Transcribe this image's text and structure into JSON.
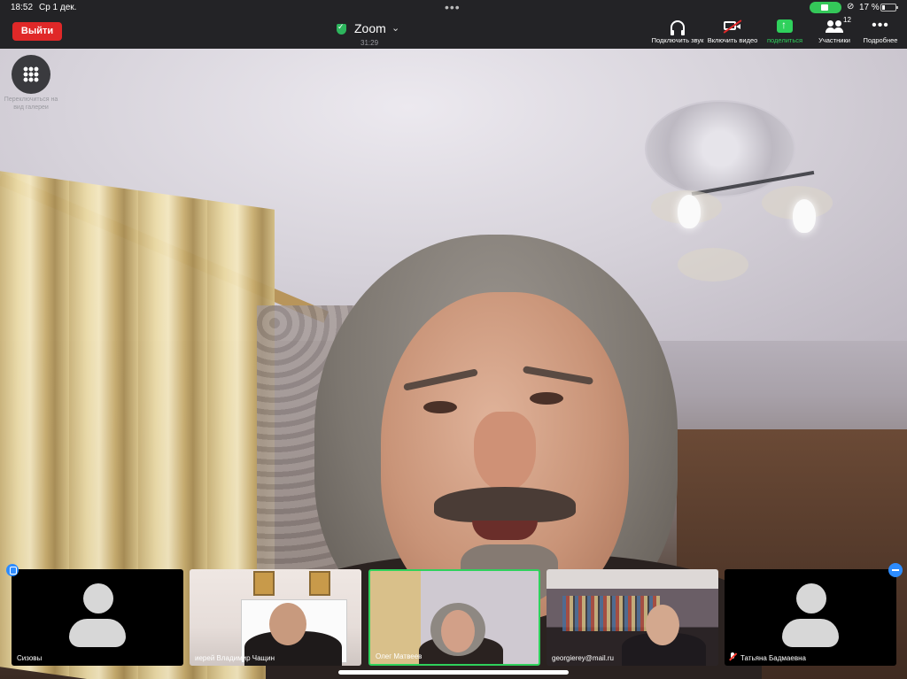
{
  "status": {
    "time": "18:52",
    "date": "Ср 1 дек.",
    "battery_percent": "17 %"
  },
  "toolbar": {
    "leave_label": "Выйти",
    "meeting_title": "Zoom",
    "timer": "31:29",
    "audio_label": "Подключить звук",
    "video_label": "Включить видео",
    "share_label": "поделиться",
    "participants_label": "Участники",
    "participants_count": "12",
    "more_label": "Подробнее"
  },
  "view": {
    "switch_label": "Переключиться на вид галереи"
  },
  "thumbnails": [
    {
      "name": "Сизовы",
      "video": false
    },
    {
      "name": "иерей Владимир Чащин",
      "video": true
    },
    {
      "name": "Олег Матвеев",
      "video": true,
      "active": true
    },
    {
      "name": "georgierey@mail.ru",
      "video": true
    },
    {
      "name": "Татьяна Бадмаевна",
      "video": false,
      "muted": true
    }
  ],
  "colors": {
    "leave": "#e02828",
    "active_speaker": "#2fd15c",
    "share": "#2fd15c",
    "badge": "#2d8cff"
  }
}
